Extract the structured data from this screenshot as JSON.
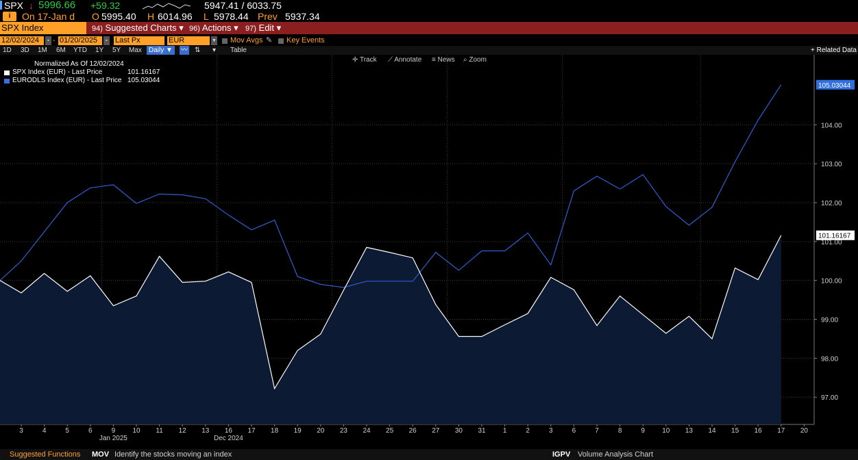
{
  "quote": {
    "ticker": "SPX",
    "arrow": "↓",
    "last": "5996.66",
    "change": "+59.32",
    "range_label": "5947.41 / 6033.75",
    "on_date": "On 17-Jan d",
    "open_label": "O",
    "open": "5995.40",
    "high_label": "H",
    "high": "6014.96",
    "low_label": "L",
    "low": "5978.44",
    "prev_label": "Prev",
    "prev": "5937.34",
    "info_icon": "i"
  },
  "command_bar": {
    "security": "SPX Index",
    "menus": [
      {
        "num": "94)",
        "label": "Suggested Charts",
        "caret": "▾"
      },
      {
        "num": "96)",
        "label": "Actions",
        "caret": "▾"
      },
      {
        "num": "97)",
        "label": "Edit",
        "caret": "▾"
      }
    ]
  },
  "params": {
    "start_date": "12/02/2024",
    "end_date": "01/20/2025",
    "separator": "-",
    "field": "Last Px",
    "currency": "EUR",
    "mov_avgs": "Mov Avgs",
    "key_events": "Key Events"
  },
  "range_buttons": [
    "1D",
    "3D",
    "1M",
    "6M",
    "YTD",
    "1Y",
    "5Y",
    "Max"
  ],
  "frequency": "Daily ▼",
  "table_label": "Table",
  "related_data": "+ Related Data",
  "chart_toolbar": [
    "Track",
    "Annotate",
    "News",
    "Zoom"
  ],
  "legend": {
    "title": "Normalized As Of 12/02/2024",
    "items": [
      {
        "label": "SPX Index (EUR) - Last Price",
        "value": "101.16167",
        "color": "#ffffff"
      },
      {
        "label": "EURODLS Index (EUR) - Last Price",
        "value": "105.03044",
        "color": "#3a6fe0"
      }
    ]
  },
  "status_bar": {
    "left_label": "Suggested Functions",
    "mov_code": "MOV",
    "mov_text": "Identify the stocks moving an index",
    "igpv_code": "IGPV",
    "igpv_text": "Volume Analysis Chart"
  },
  "colors": {
    "background": "#000000",
    "accent_orange": "#ffa028",
    "command_bar": "#8b1e1e",
    "spx_line": "#ffffff",
    "spx_fill": "#0c1a33",
    "eurodls_line": "#2f5fd0"
  },
  "chart_data": {
    "type": "line",
    "x": [
      "3",
      "4",
      "5",
      "6",
      "9",
      "10",
      "11",
      "12",
      "13",
      "16",
      "17",
      "18",
      "19",
      "20",
      "23",
      "24",
      "25",
      "26",
      "27",
      "30",
      "31",
      "1",
      "2",
      "3",
      "6",
      "7",
      "8",
      "9",
      "10",
      "13",
      "14",
      "15",
      "16",
      "17"
    ],
    "x_ticks": [
      "3",
      "4",
      "5",
      "6",
      "9",
      "10",
      "11",
      "12",
      "13",
      "16",
      "17",
      "18",
      "19",
      "20",
      "23",
      "24",
      "25",
      "26",
      "27",
      "30",
      "31",
      "1",
      "2",
      "3",
      "6",
      "7",
      "8",
      "9",
      "10",
      "13",
      "14",
      "15",
      "16",
      "17",
      "20"
    ],
    "x_month_labels": [
      {
        "label": "Dec 2024",
        "at": "16"
      },
      {
        "label": "Jan 2025",
        "at": "9"
      }
    ],
    "first_value": 100.0,
    "series": [
      {
        "name": "SPX Index (EUR) - Last Price",
        "last_label": "101.16167",
        "values": [
          99.68,
          100.18,
          99.72,
          100.12,
          99.35,
          99.6,
          100.62,
          99.95,
          99.98,
          100.22,
          99.95,
          97.22,
          98.2,
          98.62,
          99.75,
          100.85,
          100.72,
          100.58,
          99.38,
          98.56,
          98.56,
          98.86,
          99.15,
          100.08,
          99.76,
          98.84,
          99.6,
          99.12,
          98.64,
          99.08,
          98.5,
          100.32,
          100.02,
          101.16
        ]
      },
      {
        "name": "EURODLS Index (EUR) - Last Price",
        "last_label": "105.03044",
        "values": [
          100.5,
          101.25,
          102.0,
          102.38,
          102.46,
          101.98,
          102.22,
          102.2,
          102.1,
          101.68,
          101.3,
          101.55,
          100.1,
          99.9,
          99.82,
          99.98,
          99.98,
          99.98,
          100.72,
          100.26,
          100.76,
          100.76,
          101.22,
          100.4,
          102.3,
          102.68,
          102.35,
          102.72,
          101.9,
          101.42,
          101.88,
          103.05,
          104.12,
          105.03
        ]
      }
    ],
    "ylim": [
      96.3,
      105.8
    ],
    "y_ticks": [
      "97.00",
      "98.00",
      "99.00",
      "100.00",
      "101.00",
      "102.00",
      "103.00",
      "104.00"
    ],
    "grid": true
  }
}
